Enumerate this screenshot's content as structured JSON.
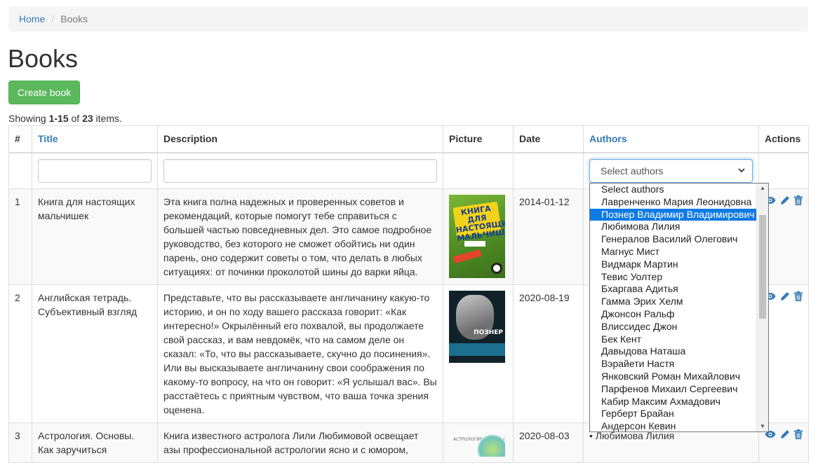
{
  "breadcrumb": {
    "home": "Home",
    "separator": "/",
    "current": "Books"
  },
  "page": {
    "title": "Books",
    "create_button": "Create book",
    "summary": {
      "prefix": "Showing ",
      "range": "1-15",
      "of": " of ",
      "total": "23",
      "suffix": " items."
    }
  },
  "table": {
    "headers": {
      "num": "#",
      "title": "Title",
      "description": "Description",
      "picture": "Picture",
      "date": "Date",
      "authors": "Authors",
      "actions": "Actions"
    },
    "filters": {
      "authors_placeholder": "Select authors"
    },
    "rows": [
      {
        "num": "1",
        "title": "Книга для настоящих мальчишек",
        "description": "Эта книга полна надежных и проверенных советов и рекомендаций, которые помогут тебе справиться с большей частью повседневных дел. Это самое подробное руководство, без которого не сможет обойтись ни один парень, оно содержит советы о том, что делать в любых ситуациях: от починки проколотой шины до варки яйца.",
        "date": "2014-01-12",
        "cover_text": "КНИГА ДЛЯ НАСТОЯЩИХ МАЛЬЧИШЕК",
        "author": ""
      },
      {
        "num": "2",
        "title": "Английская тетрадь. Субъективный взгляд",
        "description": "Представьте, что вы рассказываете англичанину какую-то историю, и он по ходу вашего рассказа говорит: «Как интересно!» Окрылённый его похвалой, вы продолжаете свой рассказ, и вам невдомёк, что на самом деле он сказал: «То, что вы рассказываете, скучно до посинения». Или вы высказываете англичанину свои соображения по какому-то вопросу, на что он говорит: «Я услышал вас». Вы расстаётесь с приятным чувством, что ваша точка зрения оценена.",
        "date": "2020-08-19",
        "cover_text": "ПОЗНЕР",
        "author": ""
      },
      {
        "num": "3",
        "title": "Астрология. Основы. Как заручиться",
        "description": "Книга известного астролога Лили Любимовой освещает азы профессиональной астрологии ясно и с юмором,",
        "date": "2020-08-03",
        "cover_text": "АСТРОЛОГИЯ. ОСНОВЫ",
        "author": "• Любимова Лилия"
      }
    ]
  },
  "dropdown": {
    "options": [
      "Select authors",
      "Лавренченко Мария Леонидовна",
      "Познер Владимир Владимирович",
      "Любимова Лилия",
      "Генералов Василий Олегович",
      "Магнус Мист",
      "Видмарк Мартин",
      "Тевис Уолтер",
      "Бхаргава Адитья",
      "Гамма Эрих Хелм",
      "Джонсон Ральф",
      "Влиссидес Джон",
      "Бек Кент",
      "Давыдова Наташа",
      "Вэрайети Настя",
      "Янковский Роман Михайлович",
      "Парфенов Михаил Сергеевич",
      "Кабир Максим Ахмадович",
      "Герберт Брайан",
      "Андерсон Кевин"
    ],
    "selected_index": 2,
    "colors": {
      "selected_bg": "#0f7ae5"
    }
  },
  "colors": {
    "link": "#337ab7",
    "success": "#5cb85c"
  }
}
